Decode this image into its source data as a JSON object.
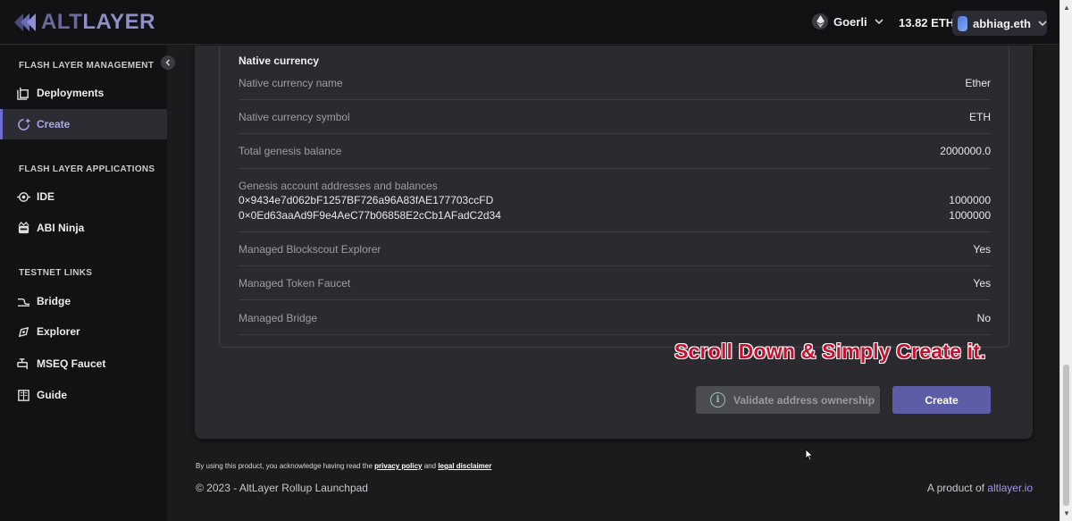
{
  "header": {
    "logo_alt": "ALT",
    "logo_layer": "LAYER",
    "network": "Goerli",
    "balance": "13.82 ETH",
    "account": "abhiag.eth"
  },
  "sidebar": {
    "sections": [
      {
        "title": "FLASH LAYER MANAGEMENT",
        "items": [
          {
            "label": "Deployments",
            "icon": "deployments-icon"
          },
          {
            "label": "Create",
            "icon": "create-icon",
            "active": true
          }
        ]
      },
      {
        "title": "FLASH LAYER APPLICATIONS",
        "items": [
          {
            "label": "IDE",
            "icon": "ide-icon"
          },
          {
            "label": "ABI Ninja",
            "icon": "ninja-icon"
          }
        ]
      },
      {
        "title": "TESTNET LINKS",
        "items": [
          {
            "label": "Bridge",
            "icon": "bridge-icon"
          },
          {
            "label": "Explorer",
            "icon": "explorer-icon"
          },
          {
            "label": "MSEQ Faucet",
            "icon": "faucet-icon"
          },
          {
            "label": "Guide",
            "icon": "guide-icon"
          }
        ]
      }
    ]
  },
  "details": {
    "title": "Native currency",
    "native_name": {
      "label": "Native currency name",
      "value": "Ether"
    },
    "native_symbol": {
      "label": "Native currency symbol",
      "value": "ETH"
    },
    "genesis_balance": {
      "label": "Total genesis balance",
      "value": "2000000.0"
    },
    "genesis_accounts": {
      "label": "Genesis account addresses and balances",
      "accounts": [
        {
          "address": "0×9434e7d062bF1257BF726a96A83fAE177703ccFD",
          "balance": "1000000"
        },
        {
          "address": "0×0Ed63aaAd9F9e4AeC77b06858E2cCb1AFadC2d34",
          "balance": "1000000"
        }
      ]
    },
    "blockscout": {
      "label": "Managed Blockscout Explorer",
      "value": "Yes"
    },
    "faucet": {
      "label": "Managed Token Faucet",
      "value": "Yes"
    },
    "bridge": {
      "label": "Managed Bridge",
      "value": "No"
    }
  },
  "overlay": "Scroll Down & Simply Create it.",
  "actions": {
    "validate": "Validate address ownership",
    "create": "Create"
  },
  "footer": {
    "legal_prefix": "By using this product, you acknowledge having read the",
    "privacy": "privacy policy",
    "and": "and",
    "disclaimer": "legal disclaimer",
    "copyright": "© 2023 - AltLayer Rollup Launchpad",
    "product_prefix": "A product of",
    "product_link": "altlayer.io"
  },
  "colors": {
    "accent": "#5d5ca6",
    "active_text": "#a8a8f0",
    "overlay_red": "#c8102e"
  }
}
